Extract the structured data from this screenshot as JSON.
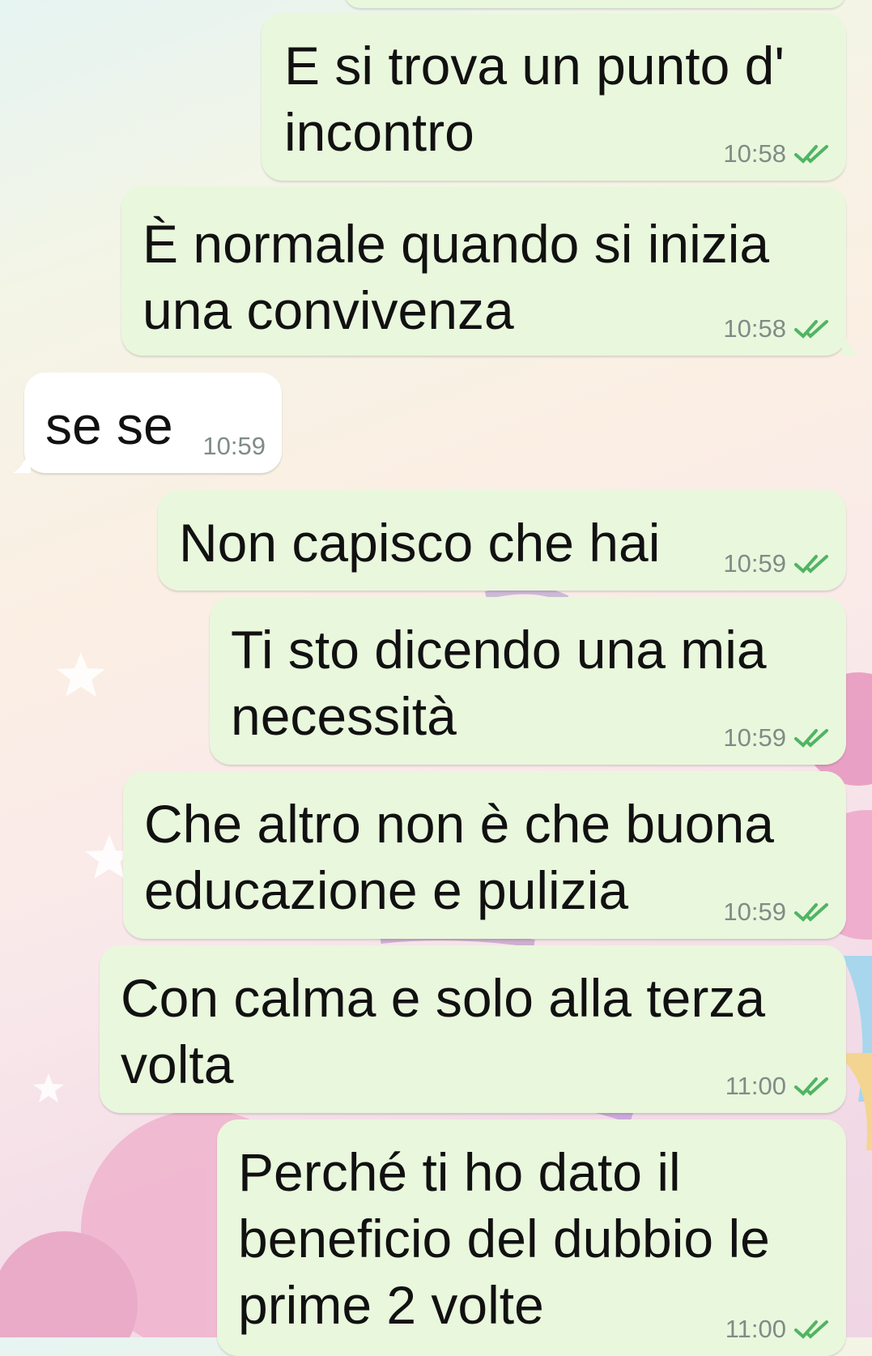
{
  "chat": {
    "messages": [
      {
        "direction": "out",
        "text": "E si trova un punto d' incontro",
        "time": "10:58",
        "status": "read"
      },
      {
        "direction": "out",
        "text": "È normale quando si inizia una convivenza",
        "time": "10:58",
        "status": "read"
      },
      {
        "direction": "in",
        "text": "se se",
        "time": "10:59"
      },
      {
        "direction": "out",
        "text": "Non capisco che hai",
        "time": "10:59",
        "status": "read"
      },
      {
        "direction": "out",
        "text": "Ti sto dicendo una mia necessità",
        "time": "10:59",
        "status": "read"
      },
      {
        "direction": "out",
        "text": "Che altro non è che buona educazione e pulizia",
        "time": "10:59",
        "status": "read"
      },
      {
        "direction": "out",
        "text": "Con calma e solo alla terza volta",
        "time": "11:00",
        "status": "read"
      },
      {
        "direction": "out",
        "text": "Perché ti ho dato il beneficio del dubbio le prime 2 volte",
        "time": "11:00",
        "status": "read"
      }
    ]
  },
  "colors": {
    "outgoing_bubble": "#e9f7dd",
    "incoming_bubble": "#ffffff",
    "read_tick": "#4fb563",
    "timestamp": "#7f8c86"
  },
  "icons": {
    "read_receipt": "double-check-icon"
  }
}
